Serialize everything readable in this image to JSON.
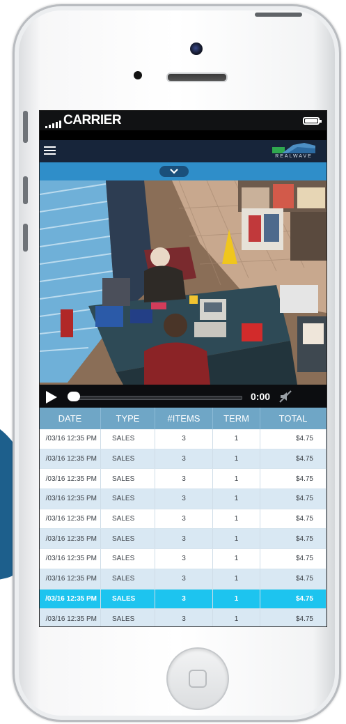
{
  "status_bar": {
    "carrier": "CARRIER"
  },
  "app_bar": {
    "logo_text": "REALWAVE",
    "menu_icon": "hamburger-menu-icon",
    "expand_icon": "chevron-down-icon"
  },
  "video_player": {
    "time": "0:00",
    "progress": 0,
    "play_icon": "play-icon",
    "mute_icon": "mute-icon"
  },
  "table": {
    "columns": [
      "DATE",
      "TYPE",
      "#ITEMS",
      "TERM",
      "TOTAL"
    ],
    "rows": [
      {
        "date": "/03/16  12:35 PM",
        "type": "SALES",
        "items": "3",
        "term": "1",
        "total": "$4.75"
      },
      {
        "date": "/03/16  12:35 PM",
        "type": "SALES",
        "items": "3",
        "term": "1",
        "total": "$4.75"
      },
      {
        "date": "/03/16  12:35 PM",
        "type": "SALES",
        "items": "3",
        "term": "1",
        "total": "$4.75"
      },
      {
        "date": "/03/16  12:35 PM",
        "type": "SALES",
        "items": "3",
        "term": "1",
        "total": "$4.75"
      },
      {
        "date": "/03/16  12:35 PM",
        "type": "SALES",
        "items": "3",
        "term": "1",
        "total": "$4.75"
      },
      {
        "date": "/03/16  12:35 PM",
        "type": "SALES",
        "items": "3",
        "term": "1",
        "total": "$4.75"
      },
      {
        "date": "/03/16  12:35 PM",
        "type": "SALES",
        "items": "3",
        "term": "1",
        "total": "$4.75"
      },
      {
        "date": "/03/16  12:35 PM",
        "type": "SALES",
        "items": "3",
        "term": "1",
        "total": "$4.75"
      },
      {
        "date": "/03/16  12:35 PM",
        "type": "SALES",
        "items": "3",
        "term": "1",
        "total": "$4.75"
      },
      {
        "date": "/03/16  12:35 PM",
        "type": "SALES",
        "items": "3",
        "term": "1",
        "total": "$4.75"
      }
    ],
    "selected_row": 8
  },
  "colors": {
    "app_bar": "#17253a",
    "drawer": "#2f8ec9",
    "table_header": "#6fa6c6",
    "row_alt": "#d9e8f3",
    "row_selected": "#1dc4ef"
  }
}
